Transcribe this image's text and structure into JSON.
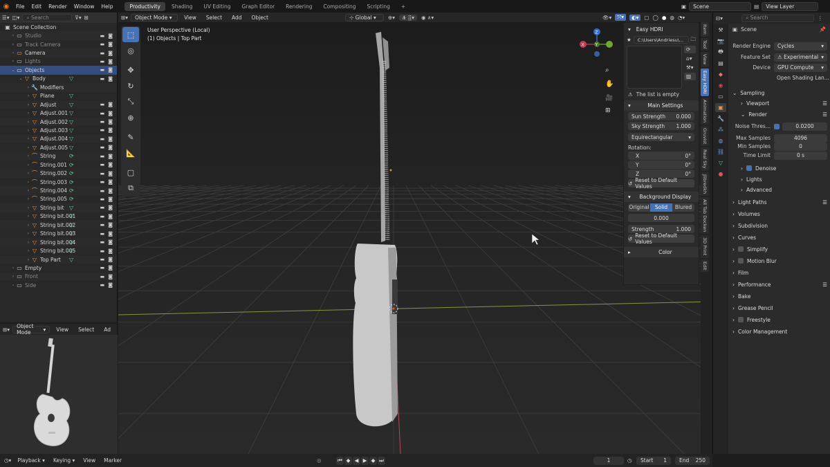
{
  "top_menu": [
    "File",
    "Edit",
    "Render",
    "Window",
    "Help"
  ],
  "workspaces": [
    {
      "label": "Productivity",
      "active": true
    },
    {
      "label": "Shading",
      "active": false
    },
    {
      "label": "UV Editing",
      "active": false
    },
    {
      "label": "Graph Editor",
      "active": false
    },
    {
      "label": "Rendering",
      "active": false
    },
    {
      "label": "Compositing",
      "active": false
    },
    {
      "label": "Scripting",
      "active": false
    }
  ],
  "scene_name": "Scene",
  "view_layer": "View Layer",
  "outliner": {
    "search_placeholder": "Search",
    "root": "Scene Collection",
    "rows": [
      {
        "label": "Studio",
        "indent": 1,
        "icon": "collection-icon",
        "dim": true,
        "tri": "›"
      },
      {
        "label": "Track Camera",
        "indent": 1,
        "icon": "collection-icon",
        "dim": true,
        "tri": "›"
      },
      {
        "label": "Camera",
        "indent": 1,
        "icon": "collection-icon",
        "dim": false,
        "tri": "›"
      },
      {
        "label": "Lights",
        "indent": 1,
        "icon": "collection-icon",
        "dim": true,
        "tri": "›"
      },
      {
        "label": "Objects",
        "indent": 1,
        "icon": "collection-icon",
        "dim": false,
        "tri": "⌄",
        "sel": true
      },
      {
        "label": "Body",
        "indent": 2,
        "icon": "mesh-icon",
        "dim": false,
        "tri": "⌄"
      },
      {
        "label": "Modifiers",
        "indent": 3,
        "icon": "wrench-icon",
        "dim": false,
        "tri": "›"
      },
      {
        "label": "Plane",
        "indent": 3,
        "icon": "mesh-icon",
        "dim": false,
        "tri": "›"
      },
      {
        "label": "Adjust",
        "indent": 3,
        "icon": "mesh-icon",
        "dim": false,
        "tri": "›"
      },
      {
        "label": "Adjust.001",
        "indent": 3,
        "icon": "mesh-icon",
        "dim": false,
        "tri": "›"
      },
      {
        "label": "Adjust.002",
        "indent": 3,
        "icon": "mesh-icon",
        "dim": false,
        "tri": "›"
      },
      {
        "label": "Adjust.003",
        "indent": 3,
        "icon": "mesh-icon",
        "dim": false,
        "tri": "›"
      },
      {
        "label": "Adjust.004",
        "indent": 3,
        "icon": "mesh-icon",
        "dim": false,
        "tri": "›"
      },
      {
        "label": "Adjust.005",
        "indent": 3,
        "icon": "mesh-icon",
        "dim": false,
        "tri": "›"
      },
      {
        "label": "String",
        "indent": 3,
        "icon": "curve-icon",
        "dim": false,
        "tri": "›"
      },
      {
        "label": "String.001",
        "indent": 3,
        "icon": "curve-icon",
        "dim": false,
        "tri": "›"
      },
      {
        "label": "String.002",
        "indent": 3,
        "icon": "curve-icon",
        "dim": false,
        "tri": "›"
      },
      {
        "label": "String.003",
        "indent": 3,
        "icon": "curve-icon",
        "dim": false,
        "tri": "›"
      },
      {
        "label": "String.004",
        "indent": 3,
        "icon": "curve-icon",
        "dim": false,
        "tri": "›"
      },
      {
        "label": "String.005",
        "indent": 3,
        "icon": "curve-icon",
        "dim": false,
        "tri": "›"
      },
      {
        "label": "String bit",
        "indent": 3,
        "icon": "mesh-icon",
        "dim": false,
        "tri": "›"
      },
      {
        "label": "String bit.001",
        "indent": 3,
        "icon": "mesh-icon",
        "dim": false,
        "tri": "›"
      },
      {
        "label": "String bit.002",
        "indent": 3,
        "icon": "mesh-icon",
        "dim": false,
        "tri": "›"
      },
      {
        "label": "String bit.003",
        "indent": 3,
        "icon": "mesh-icon",
        "dim": false,
        "tri": "›"
      },
      {
        "label": "String bit.004",
        "indent": 3,
        "icon": "mesh-icon",
        "dim": false,
        "tri": "›"
      },
      {
        "label": "String bit.005",
        "indent": 3,
        "icon": "mesh-icon",
        "dim": false,
        "tri": "›"
      },
      {
        "label": "Top Part",
        "indent": 3,
        "icon": "mesh-icon",
        "dim": false,
        "tri": "›",
        "active": true
      },
      {
        "label": "Empty",
        "indent": 1,
        "icon": "collection-icon",
        "dim": false,
        "tri": "›"
      },
      {
        "label": "Front",
        "indent": 1,
        "icon": "collection-icon",
        "dim": true,
        "tri": "›"
      },
      {
        "label": "Side",
        "indent": 1,
        "icon": "collection-icon",
        "dim": true,
        "tri": "›"
      }
    ]
  },
  "thumb_view": {
    "mode": "Object Mode",
    "menus": [
      "View",
      "Select",
      "Ad"
    ]
  },
  "viewport": {
    "mode": "Object Mode",
    "menus": [
      "View",
      "Select",
      "Add",
      "Object"
    ],
    "transform": "Global",
    "info_line1": "User Perspective (Local)",
    "info_line2": "(1) Objects | Top Part"
  },
  "easy_hdri": {
    "title": "Easy HDRI",
    "path": "C:\\Users\\Andriesu\\...",
    "empty_msg": "The list is empty",
    "main_settings": "Main Settings",
    "sun_strength_label": "Sun Strength",
    "sun_strength": "0.000",
    "sky_strength_label": "Sky Strength",
    "sky_strength": "1.000",
    "projection": "Equirectangular",
    "rotation_label": "Rotation:",
    "rot": [
      {
        "axis": "X",
        "value": "0°"
      },
      {
        "axis": "Y",
        "value": "0°"
      },
      {
        "axis": "Z",
        "value": "0°"
      }
    ],
    "reset1": "Reset to Default Values",
    "bg_display": "Background Display",
    "bg_modes": [
      "Original",
      "Solid",
      "Blured"
    ],
    "bg_value": "0.000",
    "strength_label": "Strength",
    "strength": "1.000",
    "reset2": "Reset to Default Values",
    "color": "Color"
  },
  "n_tabs": [
    "Item",
    "Tool",
    "View",
    "Easy HDRI",
    "Animation",
    "Gruvist",
    "Real Sky",
    "Jlibredkh",
    "All Tab Docken",
    "3D Print",
    "Edit"
  ],
  "properties": {
    "header": "Scene",
    "render_engine_label": "Render Engine",
    "render_engine": "Cycles",
    "feature_set_label": "Feature Set",
    "feature_set": "Experimental",
    "device_label": "Device",
    "device": "GPU Compute",
    "osl": "Open Shading Lan...",
    "sampling": "Sampling",
    "viewport": "Viewport",
    "render": "Render",
    "noise_label": "Noise Thres...",
    "noise": "0.0200",
    "max_samples_label": "Max Samples",
    "max_samples": "4096",
    "min_samples_label": "Min Samples",
    "min_samples": "0",
    "time_limit_label": "Time Limit",
    "time_limit": "0 s",
    "denoise": "Denoise",
    "lights": "Lights",
    "advanced": "Advanced",
    "sections": [
      "Light Paths",
      "Volumes",
      "Subdivision",
      "Curves",
      "Simplify",
      "Motion Blur",
      "Film",
      "Performance",
      "Bake",
      "Grease Pencil",
      "Freestyle",
      "Color Management"
    ]
  },
  "timeline": {
    "menus": [
      "Playback",
      "Keying",
      "View",
      "Marker"
    ],
    "current_frame": "1",
    "start_label": "Start",
    "start": "1",
    "end_label": "End",
    "end": "250"
  },
  "colors": {
    "accent": "#4772b3",
    "mesh": "#e69a4a",
    "curve": "#5fd39a",
    "collection": "#c8c8c8"
  }
}
